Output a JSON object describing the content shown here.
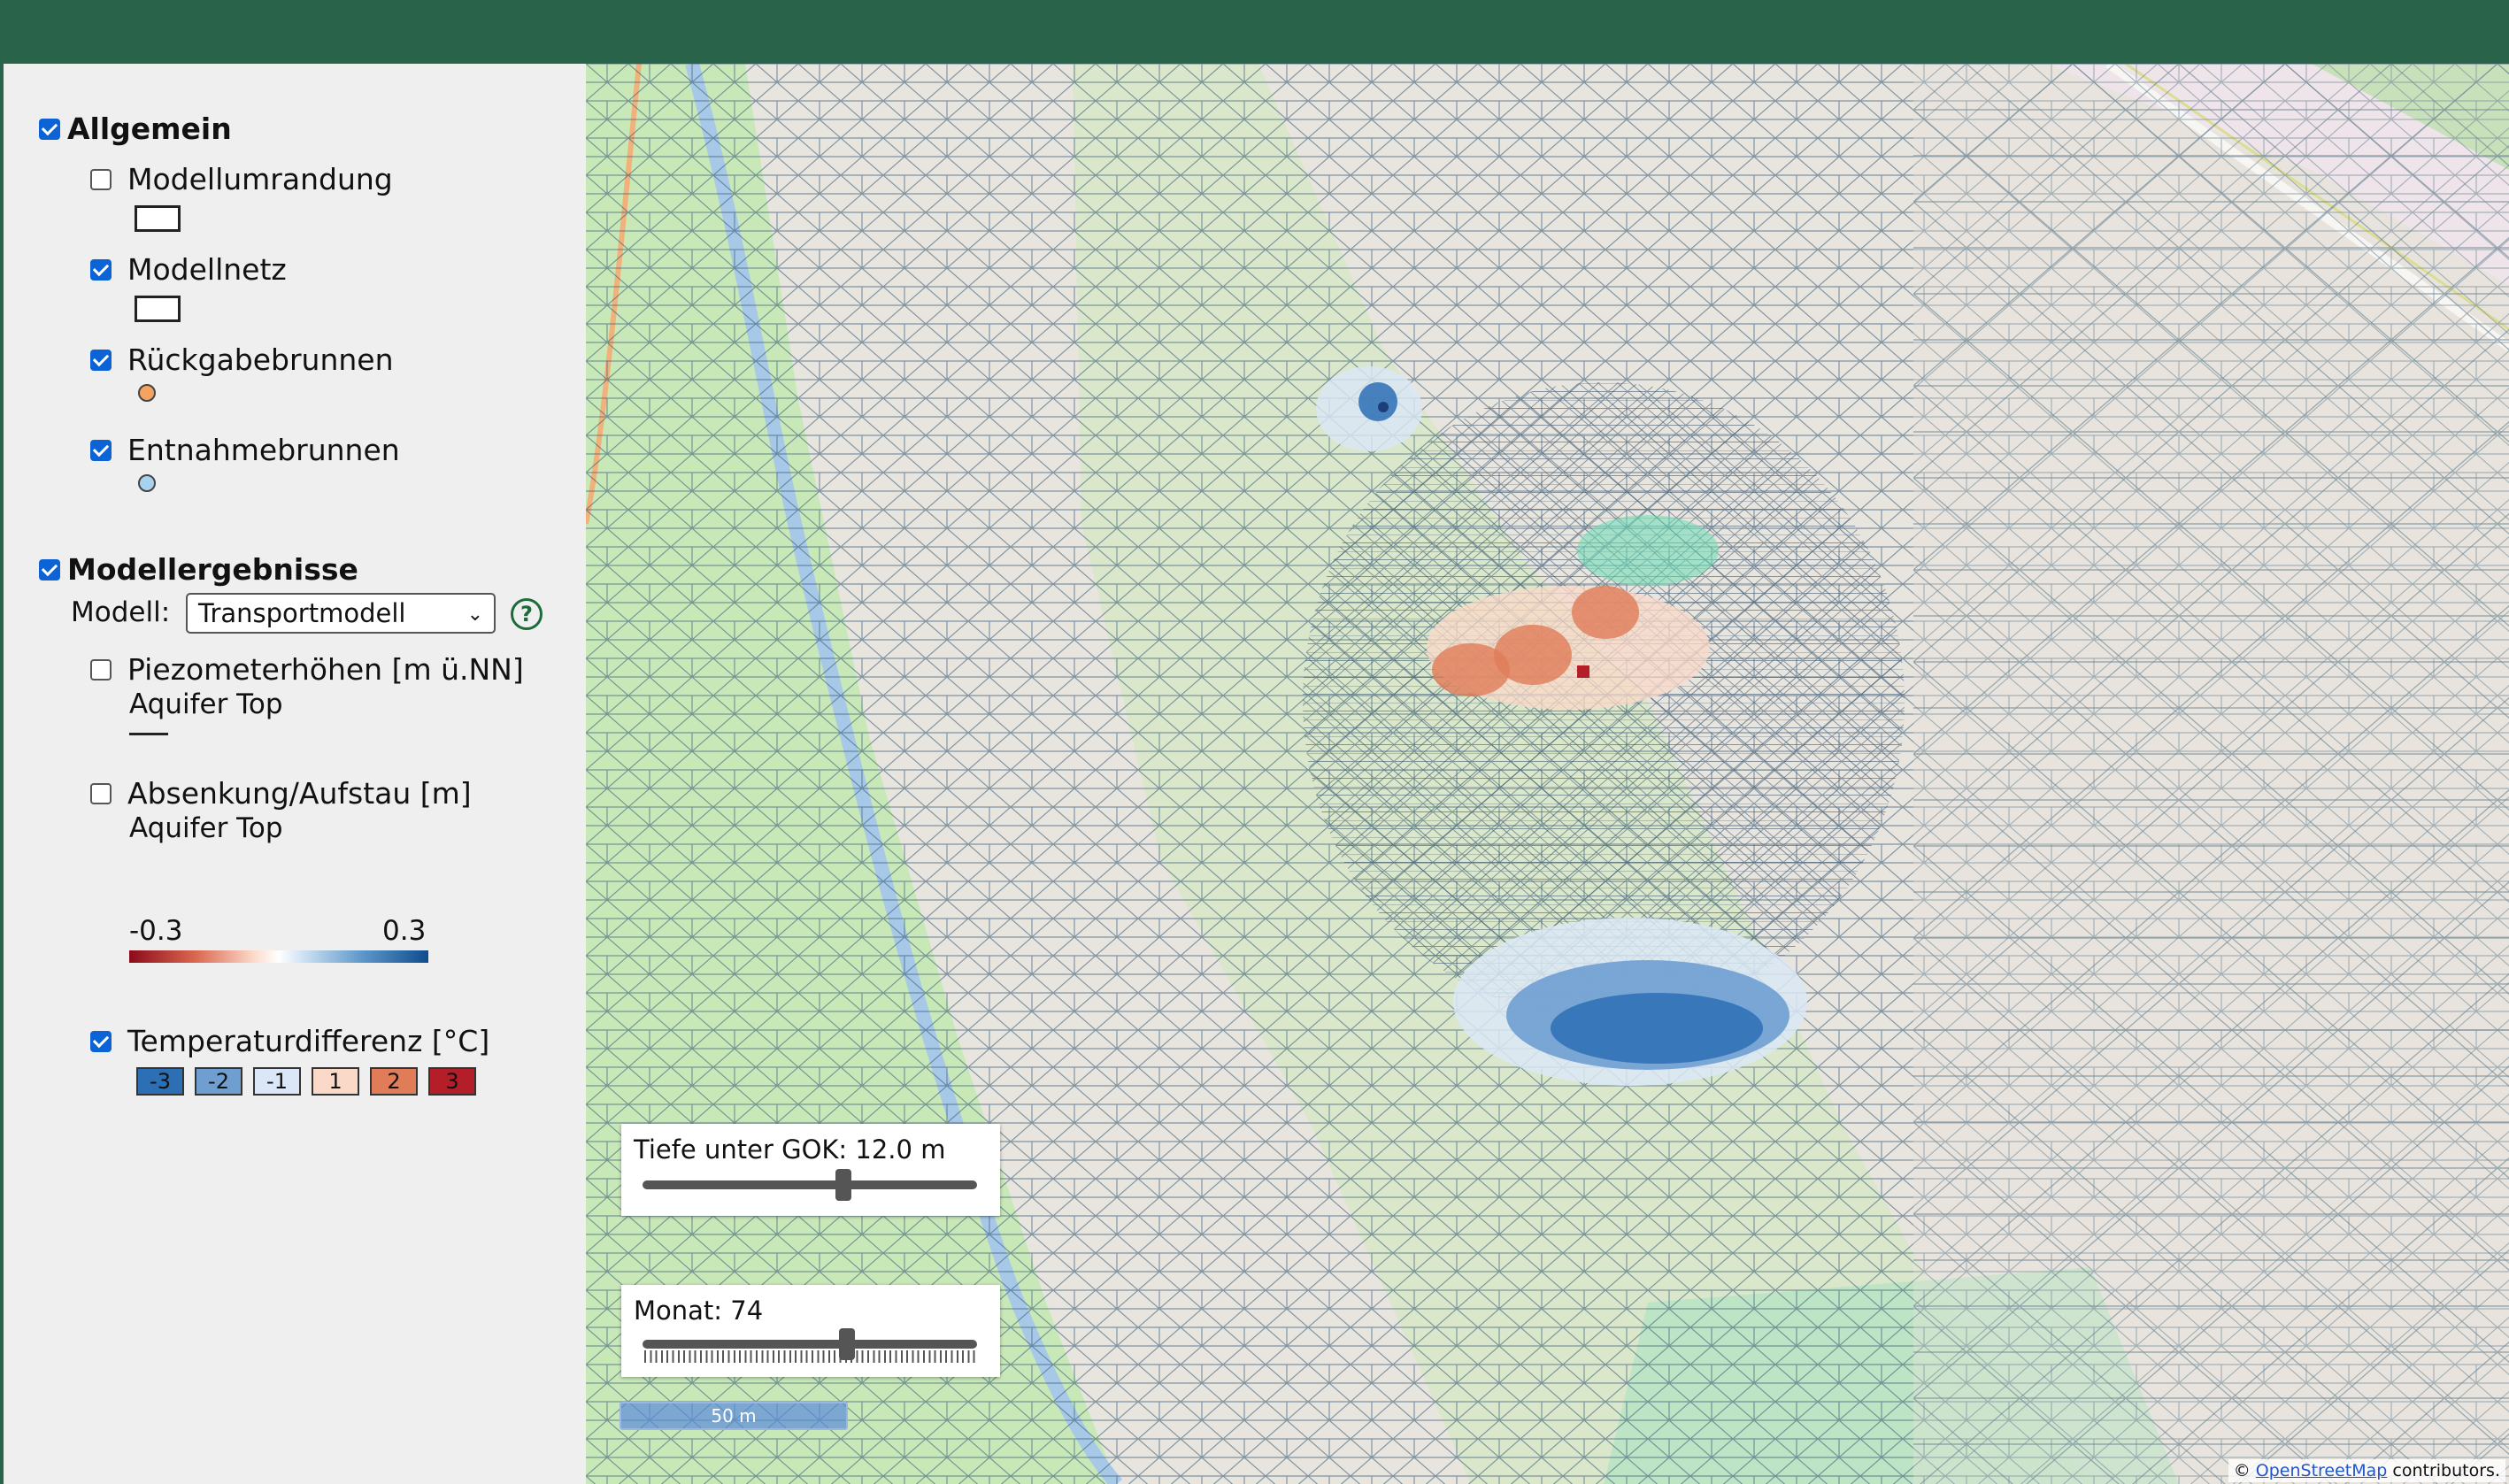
{
  "sidebar": {
    "general": {
      "label": "Allgemein",
      "checked": true,
      "items": [
        {
          "label": "Modellumrandung",
          "checked": false,
          "symbol": "rectangle"
        },
        {
          "label": "Modellnetz",
          "checked": true,
          "symbol": "rectangle"
        },
        {
          "label": "Rückgabebrunnen",
          "checked": true,
          "symbol": "circle",
          "color": "#f4a460"
        },
        {
          "label": "Entnahmebrunnen",
          "checked": true,
          "symbol": "circle",
          "color": "#a7d3f0"
        }
      ]
    },
    "results": {
      "label": "Modellergebnisse",
      "checked": true,
      "model_label": "Modell:",
      "model_value": "Transportmodell",
      "layers": [
        {
          "label": "Piezometerhöhen [m ü.NN]",
          "sublabel": "Aquifer Top",
          "checked": false,
          "symbol": "line"
        },
        {
          "label": "Absenkung/Aufstau [m]",
          "sublabel": "Aquifer Top",
          "checked": false,
          "legend_min": "-0.3",
          "legend_max": "0.3"
        },
        {
          "label": "Temperaturdifferenz [°C]",
          "checked": true,
          "legend": [
            {
              "label": "-3",
              "color": "#2c6fb5"
            },
            {
              "label": "-2",
              "color": "#6f9fd1"
            },
            {
              "label": "-1",
              "color": "#dbe7f6"
            },
            {
              "label": "1",
              "color": "#fbd9c8"
            },
            {
              "label": "2",
              "color": "#e07c57"
            },
            {
              "label": "3",
              "color": "#b31e28"
            }
          ]
        }
      ]
    }
  },
  "map": {
    "depth_label": "Tiefe unter GOK: 12.0 m",
    "depth_value_fraction": 0.6,
    "month_label": "Monat: 74",
    "month_value_fraction": 0.61,
    "scale_label": "50 m",
    "attribution_prefix": "©",
    "attribution_link": "OpenStreetMap",
    "attribution_suffix": "contributors."
  },
  "colors": {
    "header": "#29634a",
    "checkbox_on": "#0b63d6",
    "help_icon": "#1d6b3a"
  }
}
